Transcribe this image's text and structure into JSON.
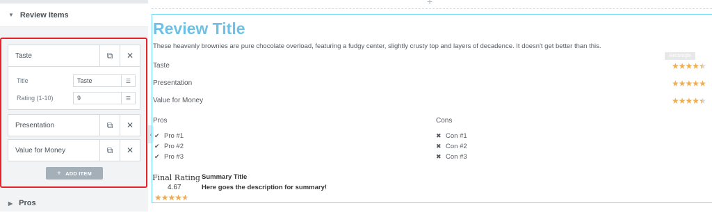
{
  "panel": {
    "review_items_label": "Review Items",
    "pros_label": "Pros",
    "items": [
      {
        "title": "Taste"
      },
      {
        "title": "Presentation"
      },
      {
        "title": "Value for Money"
      }
    ],
    "edit": {
      "title_label": "Title",
      "title_value": "Taste",
      "rating_label": "Rating (1-10)",
      "rating_value": "9"
    },
    "add_item_label": "ADD ITEM"
  },
  "preview": {
    "title": "Review Title",
    "description": "These heavenly brownies are pure chocolate overload, featuring a fudgy center, slightly crusty top and layers of decadence. It doesn't get better than this.",
    "rectangle_tag": "Rectangle",
    "ratings": [
      {
        "label": "Taste",
        "stars": 4.5
      },
      {
        "label": "Presentation",
        "stars": 5
      },
      {
        "label": "Value for Money",
        "stars": 4.5
      }
    ],
    "pros_heading": "Pros",
    "cons_heading": "Cons",
    "pros": [
      "Pro #1",
      "Pro #2",
      "Pro #3"
    ],
    "cons": [
      "Con #1",
      "Con #2",
      "Con #3"
    ],
    "final_rating_label": "Final Rating",
    "final_rating_value": "4.67",
    "final_rating_stars": 4.67,
    "summary_title": "Summary Title",
    "summary_description": "Here goes the description for summary!"
  },
  "colors": {
    "accent_title": "#6ec1e4",
    "star": "#f0ad4e",
    "highlight_border": "#e8222a",
    "preview_border": "#71d7f7"
  },
  "icons": {
    "copy": "copy-icon",
    "close": "close-icon",
    "dynamic": "database-icon",
    "check": "check-icon",
    "cross": "cross-icon",
    "caret": "caret-icon"
  }
}
